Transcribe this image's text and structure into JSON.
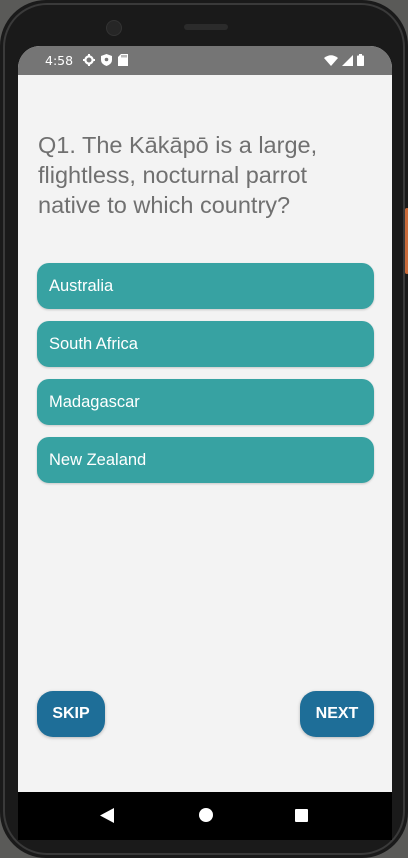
{
  "status_bar": {
    "time": "4:58",
    "left_icons": [
      "gear-icon",
      "shield-icon",
      "sd-card-icon"
    ],
    "right_icons": [
      "wifi-icon",
      "signal-icon",
      "battery-icon"
    ]
  },
  "quiz": {
    "question": "Q1. The Kākāpō is a large, flightless, nocturnal parrot native to which country?",
    "options": [
      "Australia",
      "South Africa",
      "Madagascar",
      "New Zealand"
    ]
  },
  "actions": {
    "skip_label": "SKIP",
    "next_label": "NEXT"
  },
  "nav_bar": {
    "icons": [
      "back-icon",
      "home-icon",
      "recents-icon"
    ]
  },
  "colors": {
    "option_bg": "#37a2a2",
    "action_bg": "#1e6e98",
    "screen_bg": "#f3f3f3",
    "status_bar_bg": "#757575",
    "question_text": "#707070"
  }
}
